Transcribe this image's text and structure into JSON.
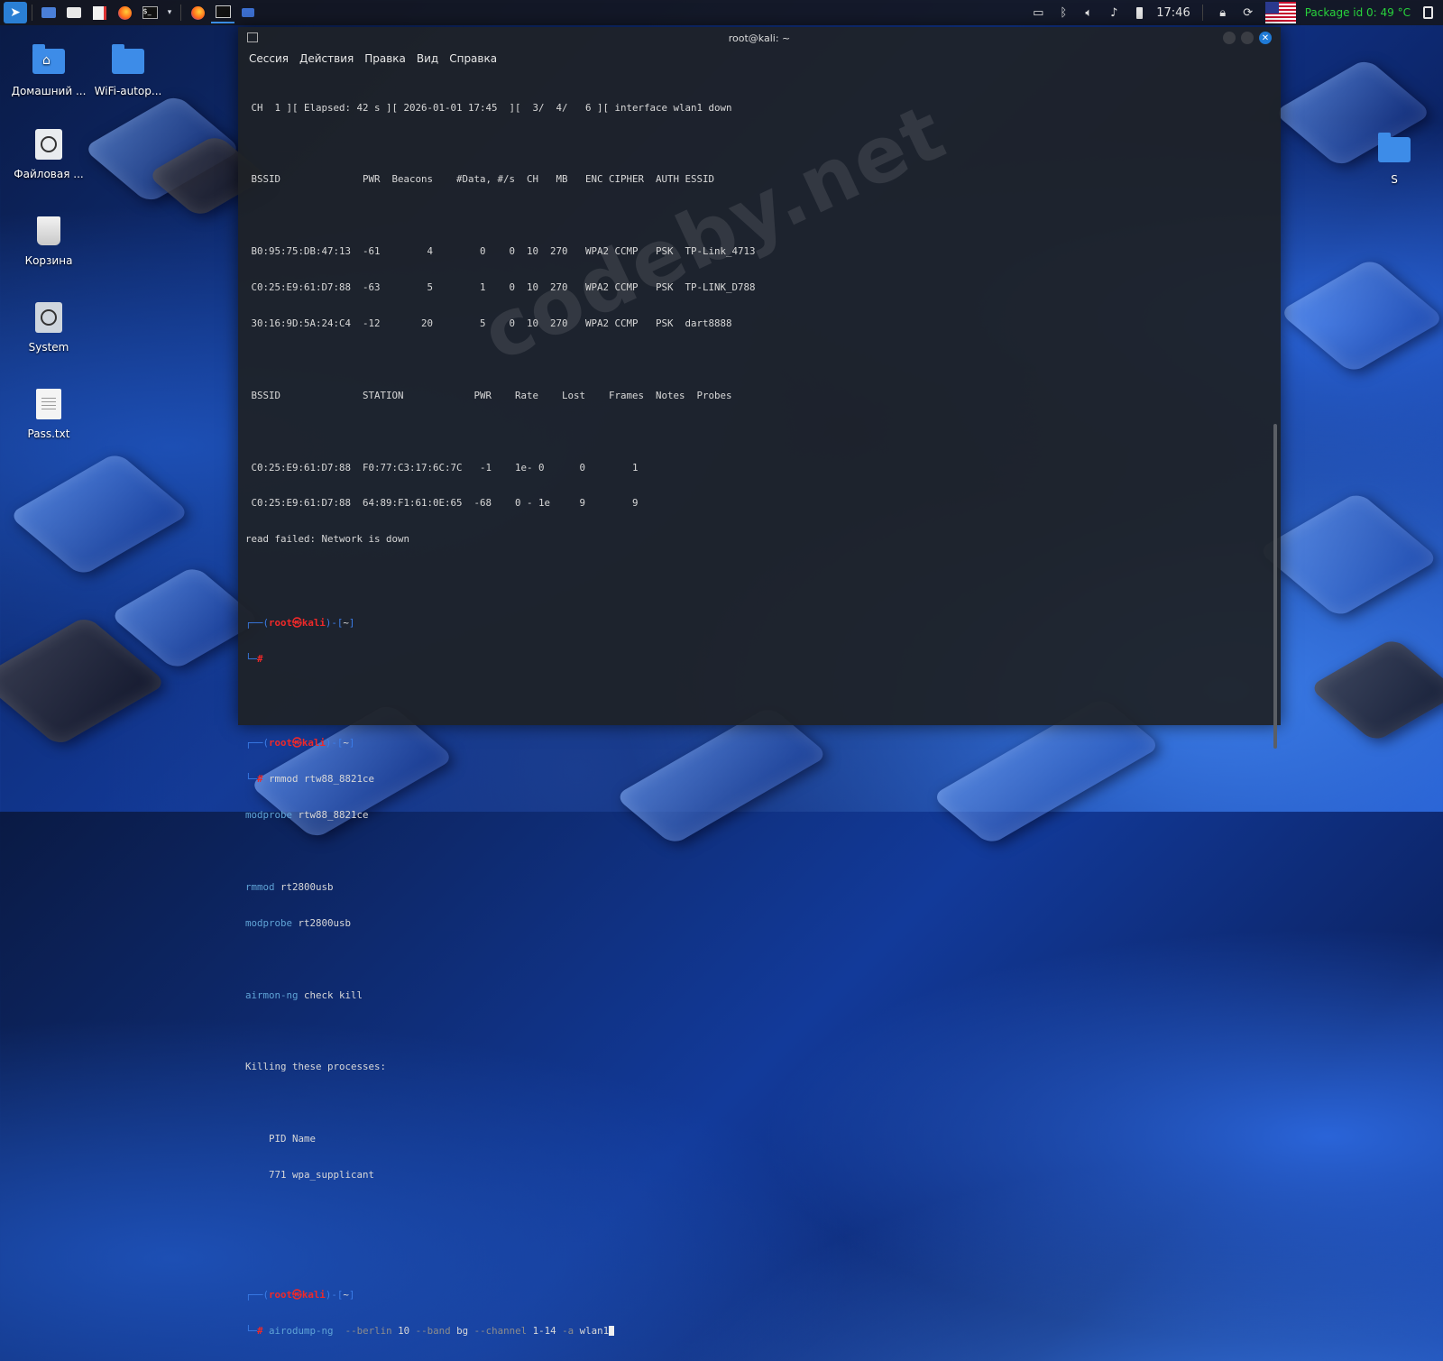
{
  "taskbar": {
    "clock": "17:46",
    "package_temp": "Package id 0: 49 °C",
    "launchers": [
      "kali-menu-icon",
      "show-desktop-icon",
      "files-icon",
      "text-editor-icon",
      "firefox-icon",
      "terminal-icon",
      "dropdown-icon",
      "firefox-icon",
      "terminal-icon",
      "workspace-icon"
    ]
  },
  "desktop": {
    "icons": [
      {
        "label": "Домашний ..."
      },
      {
        "label": "WiFi-autop..."
      },
      {
        "label": "Файловая ..."
      },
      {
        "label": "Корзина"
      },
      {
        "label": "System"
      },
      {
        "label": "Pass.txt"
      },
      {
        "label": "S"
      }
    ]
  },
  "terminal": {
    "title": "root@kali: ~",
    "menu": [
      "Сессия",
      "Действия",
      "Правка",
      "Вид",
      "Справка"
    ],
    "status_line": " CH  1 ][ Elapsed: 42 s ][ 2026-01-01 17:45  ][  3/  4/   6 ][ interface wlan1 down",
    "ap_header": " BSSID              PWR  Beacons    #Data, #/s  CH   MB   ENC CIPHER  AUTH ESSID",
    "ap_rows": [
      " B0:95:75:DB:47:13  -61        4        0    0  10  270   WPA2 CCMP   PSK  TP-Link_4713",
      " C0:25:E9:61:D7:88  -63        5        1    0  10  270   WPA2 CCMP   PSK  TP-LINK_D788",
      " 30:16:9D:5A:24:C4  -12       20        5    0  10  270   WPA2 CCMP   PSK  dart8888"
    ],
    "st_header": " BSSID              STATION            PWR    Rate    Lost    Frames  Notes  Probes",
    "st_rows": [
      " C0:25:E9:61:D7:88  F0:77:C3:17:6C:7C   -1    1e- 0      0        1",
      " C0:25:E9:61:D7:88  64:89:F1:61:0E:65  -68    0 - 1e     9        9"
    ],
    "read_failed": "read failed: Network is down",
    "prompt_user": "root㉿kali",
    "prompt_dir": "~",
    "cmd1": "rmmod rtw88_8821ce",
    "out_lines": [
      {
        "cmd": "modprobe",
        "arg": " rtw88_8821ce"
      },
      {
        "cmd": "",
        "arg": ""
      },
      {
        "cmd": "rmmod",
        "arg": " rt2800usb"
      },
      {
        "cmd": "modprobe",
        "arg": " rt2800usb"
      },
      {
        "cmd": "",
        "arg": ""
      },
      {
        "cmd": "airmon-ng",
        "arg": " check kill"
      },
      {
        "cmd": "",
        "arg": ""
      },
      {
        "cmd": "",
        "arg": "Killing these processes:"
      },
      {
        "cmd": "",
        "arg": ""
      },
      {
        "cmd": "",
        "arg": "    PID Name"
      },
      {
        "cmd": "",
        "arg": "    771 wpa_supplicant"
      }
    ],
    "final_cmd": {
      "tool": "airodump-ng",
      "args": [
        {
          "text": "  --berlin",
          "style": "grey"
        },
        {
          "text": " 10",
          "style": "plain"
        },
        {
          "text": " --band",
          "style": "grey"
        },
        {
          "text": " bg",
          "style": "plain"
        },
        {
          "text": " --channel",
          "style": "grey"
        },
        {
          "text": " 1-14",
          "style": "plain"
        },
        {
          "text": " -a",
          "style": "grey"
        },
        {
          "text": " wlan1",
          "style": "plain"
        }
      ]
    }
  },
  "watermark": "codeby.net"
}
